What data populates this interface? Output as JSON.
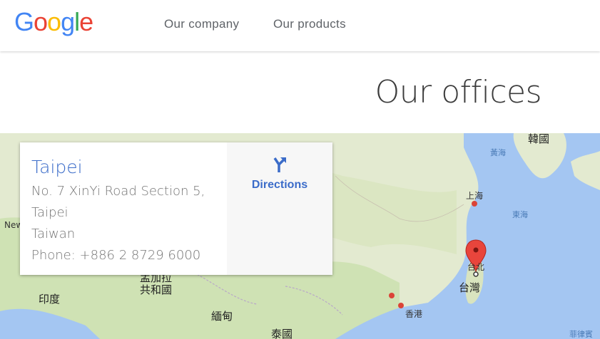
{
  "header": {
    "logo_letters": [
      {
        "ch": "G",
        "color": "#4285f4"
      },
      {
        "ch": "o",
        "color": "#ea4335"
      },
      {
        "ch": "o",
        "color": "#fbbc05"
      },
      {
        "ch": "g",
        "color": "#4285f4"
      },
      {
        "ch": "l",
        "color": "#34a853"
      },
      {
        "ch": "e",
        "color": "#ea4335"
      }
    ],
    "nav": [
      "Our company",
      "Our products"
    ]
  },
  "page": {
    "title": "Our offices"
  },
  "office_card": {
    "city": "Taipei",
    "address_lines": [
      "No. 7 XinYi Road Section 5,",
      "Taipei",
      "Taiwan"
    ],
    "phone": "Phone: +886 2 8729 6000",
    "directions_label": "Directions",
    "directions_icon": "directions-fork-icon"
  },
  "map": {
    "labels": {
      "korea": "韓國",
      "yellow_sea": "黃海",
      "shanghai": "上海",
      "east_sea": "東海",
      "taipei_cn": "台北",
      "taiwan": "台灣",
      "hong_kong": "香港",
      "myanmar": "緬甸",
      "india": "印度",
      "bangladesh": "孟加拉\n共和國",
      "thailand": "泰國",
      "philippines": "菲律賓",
      "new": "New"
    },
    "marker": "map-pin-icon",
    "colors": {
      "land": "#e8eed6",
      "water": "#a4c6f2",
      "marker": "#db4437",
      "brand_blue": "#3b6cc9"
    }
  }
}
